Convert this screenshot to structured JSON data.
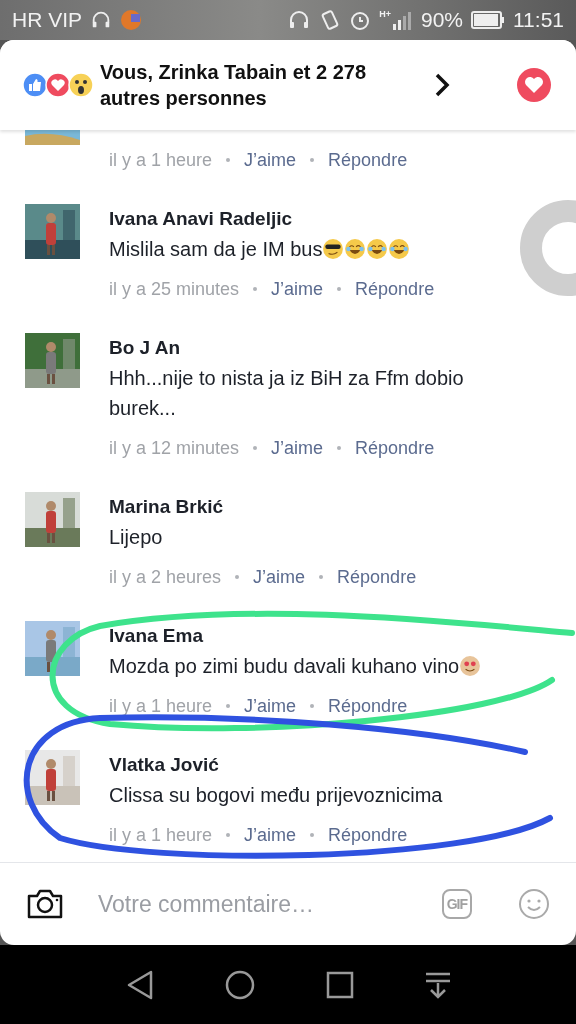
{
  "status_bar": {
    "carrier": "HR VIP",
    "network": "H+",
    "battery": "90%",
    "time": "11:51"
  },
  "header": {
    "reactions": [
      {
        "kind": "like"
      },
      {
        "kind": "love"
      },
      {
        "kind": "wow"
      }
    ],
    "text": "Vous, Zrinka Tabain et 2 278 autres personnes",
    "liked": true
  },
  "comments": [
    {
      "kind": "partial",
      "time": "il y a 1 heure",
      "like": "J’aime",
      "reply": "Répondre"
    },
    {
      "kind": "full",
      "name": "Ivana Anavi Radeljic",
      "text": "Mislila sam da je IM bus",
      "emojis": [
        {
          "kind": "cool"
        },
        {
          "kind": "laugh"
        },
        {
          "kind": "laugh"
        },
        {
          "kind": "laugh"
        }
      ],
      "time": "il y a 25 minutes",
      "like": "J’aime",
      "reply": "Répondre"
    },
    {
      "kind": "full",
      "name": "Bo J An",
      "text": "Hhh...nije to nista ja iz BiH za Ffm dobio burek...",
      "time": "il y a 12 minutes",
      "like": "J’aime",
      "reply": "Répondre"
    },
    {
      "kind": "full",
      "name": "Marina Brkić",
      "text": "Lijepo",
      "time": "il y a 2 heures",
      "like": "J’aime",
      "reply": "Répondre"
    },
    {
      "kind": "full",
      "name": "Ivana Ema",
      "text": "Mozda po zimi budu davali kuhano vino",
      "emojis": [
        {
          "kind": "hearts"
        }
      ],
      "time": "il y a 1 heure",
      "like": "J’aime",
      "reply": "Répondre"
    },
    {
      "kind": "full",
      "name": "Vlatka Jović",
      "text": "Clissa su bogovi među prijevoznicima",
      "time": "il y a 1 heure",
      "like": "J’aime",
      "reply": "Répondre"
    }
  ],
  "composer": {
    "placeholder": "Votre commentaire…",
    "gif": "GIF"
  },
  "annotations": [
    {
      "color": "#3ee38c"
    },
    {
      "color": "#2f52e0"
    }
  ]
}
